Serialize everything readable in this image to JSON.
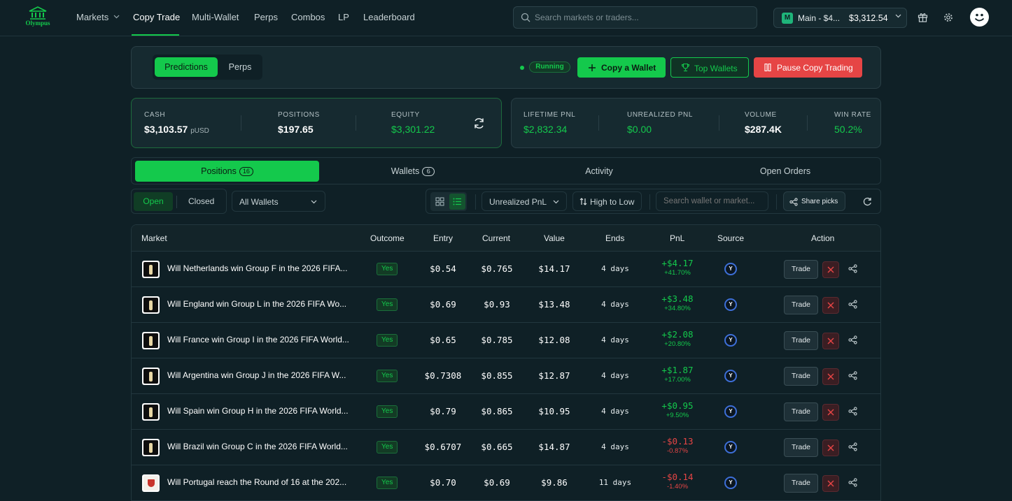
{
  "brand": {
    "name": "Olympus",
    "accent": "#14c94c",
    "danger": "#e64545"
  },
  "nav": {
    "items": [
      {
        "label": "Markets"
      },
      {
        "label": "Copy Trade"
      },
      {
        "label": "Multi-Wallet"
      },
      {
        "label": "Perps"
      },
      {
        "label": "Combos"
      },
      {
        "label": "LP"
      },
      {
        "label": "Leaderboard"
      }
    ],
    "active": "Copy Trade"
  },
  "search": {
    "placeholder": "Search markets or traders..."
  },
  "account": {
    "badge": "M",
    "name": "Main - $4...",
    "balance": "$3,312.54"
  },
  "control": {
    "segments": [
      "Predictions",
      "Perps"
    ],
    "status": "Running",
    "copy_wallet": "Copy a Wallet",
    "top_wallets": "Top Wallets",
    "pause": "Pause Copy Trading"
  },
  "summary": {
    "cash_label": "CASH",
    "cash_value": "$3,103.57",
    "cash_unit": "pUSD",
    "positions_label": "POSITIONS",
    "positions_value": "$197.65",
    "equity_label": "EQUITY",
    "equity_value": "$3,301.22"
  },
  "perf": {
    "lifetime_label": "LIFETIME PNL",
    "lifetime_value": "$2,832.34",
    "unrealized_label": "UNREALIZED PNL",
    "unrealized_value": "$0.00",
    "volume_label": "VOLUME",
    "volume_value": "$287.4K",
    "winrate_label": "WIN RATE",
    "winrate_value": "50.2%"
  },
  "tabs": [
    {
      "label": "Positions",
      "count": "16"
    },
    {
      "label": "Wallets",
      "count": "6"
    },
    {
      "label": "Activity"
    },
    {
      "label": "Open Orders"
    }
  ],
  "filters": {
    "open": "Open",
    "closed": "Closed",
    "wallet_select": "All Wallets",
    "sort_field": "Unrealized PnL",
    "sort_order": "High to Low",
    "search_placeholder": "Search wallet or market...",
    "share": "Share picks"
  },
  "table": {
    "columns": [
      "Market",
      "Outcome",
      "Entry",
      "Current",
      "Value",
      "Ends",
      "PnL",
      "Source",
      "Action"
    ],
    "trade_label": "Trade",
    "source_label": "Y",
    "rows": [
      {
        "market": "Will Netherlands win Group F in the 2026 FIFA...",
        "outcome": "Yes",
        "entry": "$0.54",
        "current": "$0.765",
        "value": "$14.17",
        "ends": "4 days",
        "pnl": "+$4.17",
        "pnl_pct": "+41.70%",
        "dir": "pos",
        "thumb": "trophy"
      },
      {
        "market": "Will England win Group L in the 2026 FIFA Wo...",
        "outcome": "Yes",
        "entry": "$0.69",
        "current": "$0.93",
        "value": "$13.48",
        "ends": "4 days",
        "pnl": "+$3.48",
        "pnl_pct": "+34.80%",
        "dir": "pos",
        "thumb": "trophy"
      },
      {
        "market": "Will France win Group I in the 2026 FIFA World...",
        "outcome": "Yes",
        "entry": "$0.65",
        "current": "$0.785",
        "value": "$12.08",
        "ends": "4 days",
        "pnl": "+$2.08",
        "pnl_pct": "+20.80%",
        "dir": "pos",
        "thumb": "trophy"
      },
      {
        "market": "Will Argentina win Group J in the 2026 FIFA W...",
        "outcome": "Yes",
        "entry": "$0.7308",
        "current": "$0.855",
        "value": "$12.87",
        "ends": "4 days",
        "pnl": "+$1.87",
        "pnl_pct": "+17.00%",
        "dir": "pos",
        "thumb": "trophy"
      },
      {
        "market": "Will Spain win Group H in the 2026 FIFA World...",
        "outcome": "Yes",
        "entry": "$0.79",
        "current": "$0.865",
        "value": "$10.95",
        "ends": "4 days",
        "pnl": "+$0.95",
        "pnl_pct": "+9.50%",
        "dir": "pos",
        "thumb": "trophy"
      },
      {
        "market": "Will Brazil win Group C in the 2026 FIFA World...",
        "outcome": "Yes",
        "entry": "$0.6707",
        "current": "$0.665",
        "value": "$14.87",
        "ends": "4 days",
        "pnl": "-$0.13",
        "pnl_pct": "-0.87%",
        "dir": "neg",
        "thumb": "trophy"
      },
      {
        "market": "Will Portugal reach the Round of 16 at the 202...",
        "outcome": "Yes",
        "entry": "$0.70",
        "current": "$0.69",
        "value": "$9.86",
        "ends": "11 days",
        "pnl": "-$0.14",
        "pnl_pct": "-1.40%",
        "dir": "neg",
        "thumb": "crest"
      }
    ]
  }
}
